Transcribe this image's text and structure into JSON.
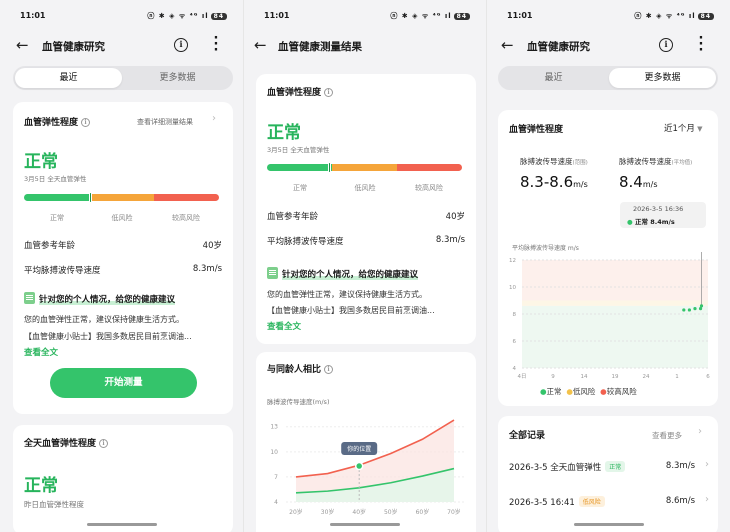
{
  "status": {
    "time": "11:01",
    "icons": "ⓝ ✱ ◈ ᯤ ⁴ᴳ ıl",
    "battery": "84"
  },
  "screen1": {
    "title": "血管健康研究",
    "tabs": [
      "最近",
      "更多数据"
    ],
    "card": {
      "title": "血管弹性程度",
      "link": "查看详细测量结果",
      "status": "正常",
      "date": "3月5日 全天血管弹性",
      "bar_labels": [
        "正常",
        "低风险",
        "较高风险"
      ],
      "marker_fraction": 0.34,
      "rows": [
        {
          "label": "血管参考年龄",
          "value": "40岁"
        },
        {
          "label": "平均脉搏波传导速度",
          "value": "8.3m/s"
        }
      ],
      "advice_title": "针对您的个人情况，给您的健康建议",
      "advice_lines": [
        "您的血管弹性正常，建议保持健康生活方式。",
        "【血管健康小贴士】我国多数居民目前烹调油..."
      ],
      "read_more": "查看全文",
      "button": "开始测量"
    },
    "card2": {
      "title": "全天血管弹性程度",
      "status": "常",
      "sub": "昨日血管弹性程度"
    }
  },
  "screen2": {
    "title": "血管健康测量结果",
    "card": {
      "title": "血管弹性程度",
      "status": "正常",
      "date": "3月5日 全天血管弹性",
      "bar_labels": [
        "正常",
        "低风险",
        "较高风险"
      ],
      "marker_fraction": 0.32,
      "rows": [
        {
          "label": "血管参考年龄",
          "value": "40岁"
        },
        {
          "label": "平均脉搏波传导速度",
          "value": "8.3m/s"
        }
      ],
      "advice_title": "针对您的个人情况，给您的健康建议",
      "advice_lines": [
        "您的血管弹性正常，建议保持健康生活方式。",
        "【血管健康小贴士】我国多数居民目前烹调油..."
      ],
      "read_more": "查看全文"
    },
    "compare": {
      "title": "与同龄人相比",
      "ylabel": "脉搏波传导速度(m/s)",
      "tooltip": "你的位置"
    }
  },
  "screen3": {
    "title": "血管健康研究",
    "tabs": [
      "最近",
      "更多数据"
    ],
    "card": {
      "title": "血管弹性程度",
      "period": "近1个月",
      "range_label": "脉搏波传导速度",
      "range_note": "(范围)",
      "range_value": "8.3-8.6",
      "avg_label": "脉搏波传导速度",
      "avg_note": "(平均值)",
      "avg_value": "8.4",
      "unit": "m/s",
      "tip_date": "2026-3-5 16:36",
      "tip_value": "正常 8.4m/s",
      "ylabel": "平均脉搏波传导速度 m/s",
      "legend": [
        "正常",
        "低风险",
        "较高风险"
      ]
    },
    "records": {
      "title": "全部记录",
      "more": "查看更多",
      "items": [
        {
          "time": "2026-3-5 全天血管弹性",
          "tag": "正常",
          "value": "8.3m/s"
        },
        {
          "time": "2026-3-5 16:41",
          "tag": "低风险",
          "value": "8.6m/s"
        }
      ]
    }
  },
  "colors": {
    "green": "#34c46b",
    "orange": "#f5a53a",
    "red": "#f2614f",
    "yellow": "#f3c24a"
  },
  "chart_data": [
    {
      "type": "line",
      "title": "与同龄人相比",
      "ylabel": "脉搏波传导速度(m/s)",
      "categories": [
        "20岁",
        "30岁",
        "40岁",
        "50岁",
        "60岁",
        "70岁"
      ],
      "yticks": [
        4,
        7,
        10,
        13
      ],
      "ylim": [
        4,
        15
      ],
      "series": [
        {
          "name": "",
          "color": "#f2614f",
          "values": [
            7.0,
            7.4,
            8.4,
            9.8,
            11.5,
            13.8
          ]
        },
        {
          "name": "",
          "color": "#34c46b",
          "values": [
            5.1,
            5.3,
            5.7,
            6.3,
            7.1,
            8.0
          ]
        }
      ],
      "point": {
        "x": "40岁",
        "y": 8.3,
        "label": "你的位置"
      }
    },
    {
      "type": "scatter",
      "title": "血管弹性程度",
      "ylabel": "平均脉搏波传导速度 m/s",
      "xticks": [
        "4日",
        "9",
        "14",
        "19",
        "24",
        "1",
        "6"
      ],
      "yticks": [
        4,
        6,
        8,
        10,
        12
      ],
      "ylim": [
        4,
        12
      ],
      "legend": [
        "正常",
        "低风险",
        "较高风险"
      ],
      "points": [
        {
          "x": 0.87,
          "y": 8.3
        },
        {
          "x": 0.9,
          "y": 8.3
        },
        {
          "x": 0.93,
          "y": 8.4
        },
        {
          "x": 0.96,
          "y": 8.4
        },
        {
          "x": 0.965,
          "y": 8.6
        }
      ]
    }
  ]
}
